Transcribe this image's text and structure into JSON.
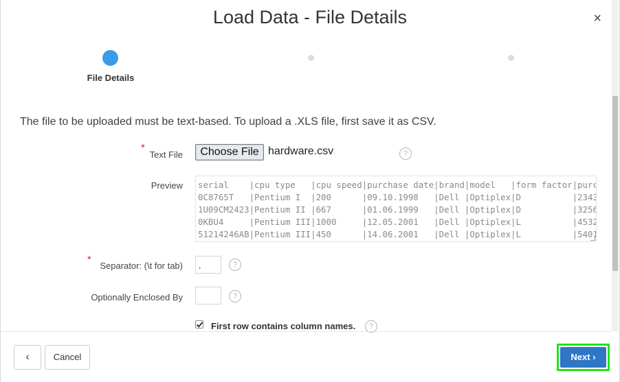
{
  "dialog": {
    "title": "Load Data - File Details",
    "close_glyph": "×"
  },
  "wizard": {
    "active_step_label": "File Details"
  },
  "info_text": "The file to be uploaded must be text-based. To upload a .XLS file, first save it as CSV.",
  "form": {
    "required_marker": "*",
    "text_file": {
      "label": "Text File",
      "button_label": "Choose File",
      "file_name": "hardware.csv"
    },
    "preview": {
      "label": "Preview",
      "lines": [
        "serial    |cpu type   |cpu speed|purchase date|brand|model   |form factor|purc",
        "0C8765T   |Pentium I  |200      |09.10.1998   |Dell |Optiplex|D          |2343",
        "1U09CM2423|Pentium II |667      |01.06.1999   |Dell |Optiplex|D          |3256",
        "0KBU4     |Pentium III|1000     |12.05.2001   |Dell |Optiplex|L          |4532",
        "51214246AB|Pentium III|450      |14.06.2001   |Dell |Optiplex|L          |5401"
      ]
    },
    "separator": {
      "label": "Separator: (\\t for tab)",
      "value": ","
    },
    "enclosed_by": {
      "label": "Optionally Enclosed By",
      "value": ""
    },
    "first_row": {
      "label": "First row contains column names.",
      "checked": true
    },
    "help_glyph": "?"
  },
  "footer": {
    "back_glyph": "‹",
    "cancel_label": "Cancel",
    "next_label": "Next",
    "next_glyph": "›"
  },
  "colors": {
    "accent": "#3b9beb",
    "primary_button": "#2d76c8",
    "highlight": "#21e21b",
    "required": "#e0282a"
  }
}
